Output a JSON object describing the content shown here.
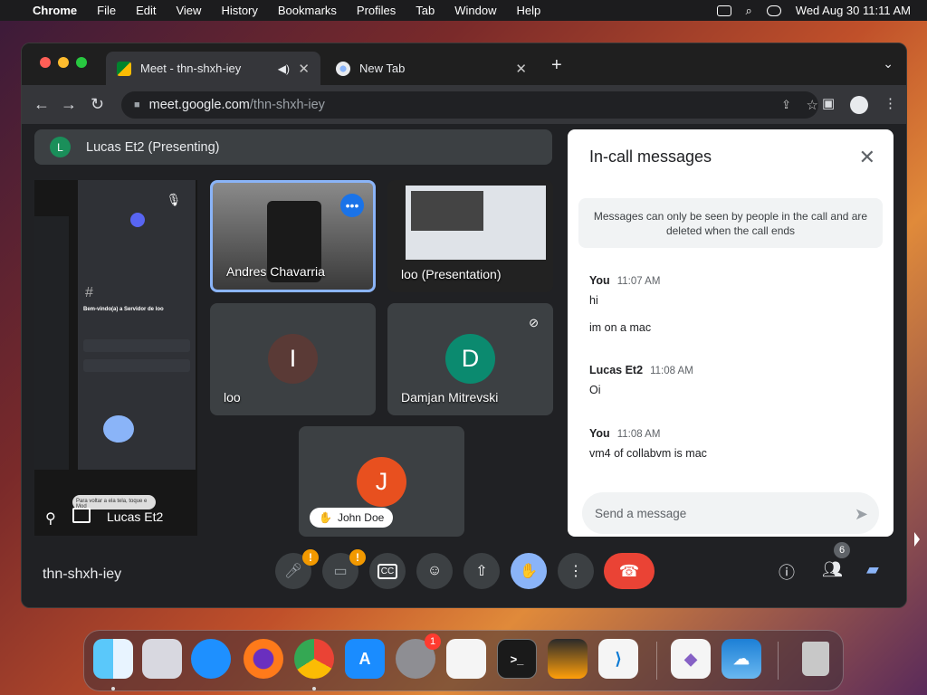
{
  "menubar": {
    "apple": "",
    "app": "Chrome",
    "items": [
      "File",
      "Edit",
      "View",
      "History",
      "Bookmarks",
      "Profiles",
      "Tab",
      "Window",
      "Help"
    ],
    "datetime": "Wed Aug 30  11:11 AM"
  },
  "browser": {
    "tabs": [
      {
        "title": "Meet - thn-shxh-iey",
        "audio_icon": "speaker-icon"
      },
      {
        "title": "New Tab"
      }
    ],
    "url_host": "meet.google.com",
    "url_path": "/thn-shxh-iey"
  },
  "meet": {
    "presenting_avatar": "L",
    "presenting_label": "Lucas Et2 (Presenting)",
    "main_tile_name": "Lucas Et2",
    "phone_screen": {
      "heading": "Bem-vindo(a) a Servidor de loo",
      "tooltip": "Para voltar a ela tela, toque e Mod"
    },
    "participants": [
      {
        "name": "Andres Chavarria",
        "type": "video"
      },
      {
        "name": "loo (Presentation)",
        "type": "presentation"
      },
      {
        "name": "loo",
        "initial": "I",
        "color": "#5a3a36"
      },
      {
        "name": "Damjan Mitrevski",
        "initial": "D",
        "color": "#0b8a6f",
        "muted": true
      },
      {
        "name": "John Doe",
        "initial": "J",
        "color": "#e8501f",
        "hand_raised": true
      }
    ],
    "meeting_code": "thn-shxh-iey",
    "people_count": "6",
    "warn_mark": "!"
  },
  "chat": {
    "title": "In-call messages",
    "notice": "Messages can only be seen by people in the call and are deleted when the call ends",
    "messages": [
      {
        "sender": "You",
        "time": "11:07 AM",
        "lines": [
          "hi",
          "im on a mac"
        ]
      },
      {
        "sender": "Lucas Et2",
        "time": "11:08 AM",
        "lines": [
          "Oi"
        ]
      },
      {
        "sender": "You",
        "time": "11:08 AM",
        "lines": [
          "vm4 of collabvm is mac"
        ]
      }
    ],
    "input_placeholder": "Send a message"
  },
  "dock": {
    "apps": [
      "Finder",
      "Launchpad",
      "Safari",
      "Firefox",
      "Chrome",
      "App Store",
      "System Settings",
      "TextEdit",
      "Terminal",
      "GarageBand",
      "Visual Studio Code",
      "Visual Studio",
      "Weather",
      "Trash"
    ],
    "system_settings_badge": "1"
  },
  "colors": {
    "accent": "#8ab4f8",
    "end_call": "#ea4335",
    "warning": "#f29900"
  }
}
